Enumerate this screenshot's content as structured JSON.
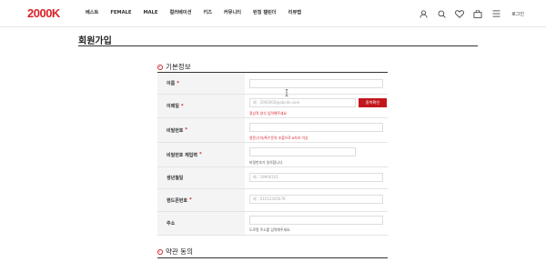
{
  "header": {
    "logo": "2000K",
    "nav": [
      "베스트",
      "FEMALE",
      "MALE",
      "컬러베이션",
      "키즈",
      "커뮤니티",
      "런칭 캘린더",
      "리뷰랩"
    ],
    "login_label": "로그인"
  },
  "page": {
    "title": "회원가입"
  },
  "sections": {
    "basic": "기본정보",
    "terms": "약관 동의"
  },
  "form": {
    "name": {
      "label": "이름",
      "required": "*"
    },
    "email": {
      "label": "이메일",
      "required": "*",
      "placeholder": "예 : 2000000@abcde.com",
      "button": "중복확인",
      "hint": "정상적 양식 입력해주세요"
    },
    "password": {
      "label": "비밀번호",
      "required": "*",
      "hint": "영문/숫자/특수문자 조합으로 8자리 이상"
    },
    "password_confirm": {
      "label": "비밀번호 재입력",
      "required": "*",
      "hint": "비밀번호가 일치합니다."
    },
    "birth": {
      "label": "생년월일",
      "placeholder": "예 : 19900101"
    },
    "phone": {
      "label": "핸드폰번호",
      "required": "*",
      "placeholder": "예 : 01012345678"
    },
    "address": {
      "label": "주소",
      "hint": "도로명 주소를 입력해주세요."
    }
  },
  "colors": {
    "accent": "#d8232a",
    "button": "#c3161c"
  }
}
